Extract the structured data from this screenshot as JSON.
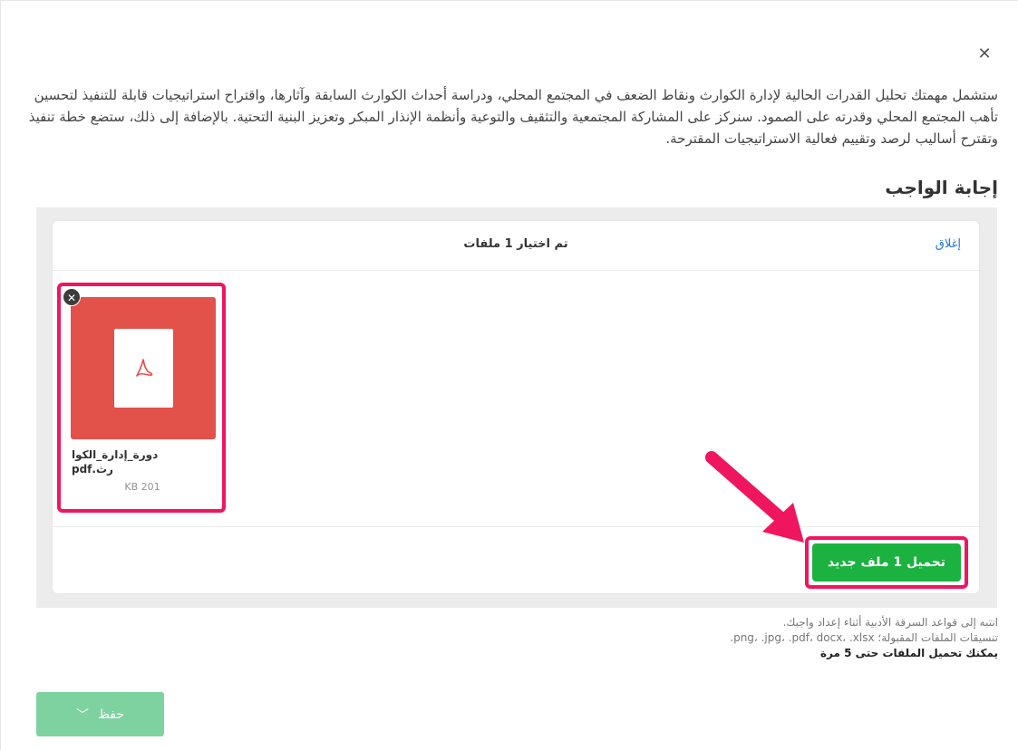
{
  "modal": {
    "close_icon": "close-icon",
    "description": "ستشمل مهمتك تحليل القدرات الحالية لإدارة الكوارث ونقاط الضعف في المجتمع المحلي، ودراسة أحداث الكوارث السابقة وآثارها، واقتراح استراتيجيات قابلة للتنفيذ لتحسين تأهب المجتمع المحلي وقدرته على الصمود. سنركز على المشاركة المجتمعية والتثقيف والتوعية وأنظمة الإنذار المبكر وتعزيز البنية التحتية. بالإضافة إلى ذلك، ستضع خطة تنفيذ وتقترح أساليب لرصد وتقييم فعالية الاستراتيجيات المقترحة.",
    "answer_title": "إجابة الواجب"
  },
  "uploader": {
    "header_title": "تم اختيار 1 ملفات",
    "close_label": "إغلاق",
    "file": {
      "name_line1": "دورة_إدارة_الكوا",
      "name_line2": "رث.pdf",
      "size": "KB 201",
      "type_icon": "pdf-icon",
      "thumb_color": "#e2514a"
    },
    "upload_button": "تحميل 1 ملف جديد",
    "upload_color": "#1bb240",
    "highlight_color": "#f0155f"
  },
  "notes": {
    "line1": "انتبه إلى قواعد السرقة الأدبية أثناء إعداد واجبك.",
    "line2": "تنسيقات الملفات المقبولة؛ png، .jpg، .pdf، docx، .xlsx.",
    "line3": "يمكنك تحميل الملفات حتى 5 مرة"
  },
  "save": {
    "label": "حفظ",
    "icon": "chevron-down-icon",
    "color": "#7ed2a0"
  }
}
